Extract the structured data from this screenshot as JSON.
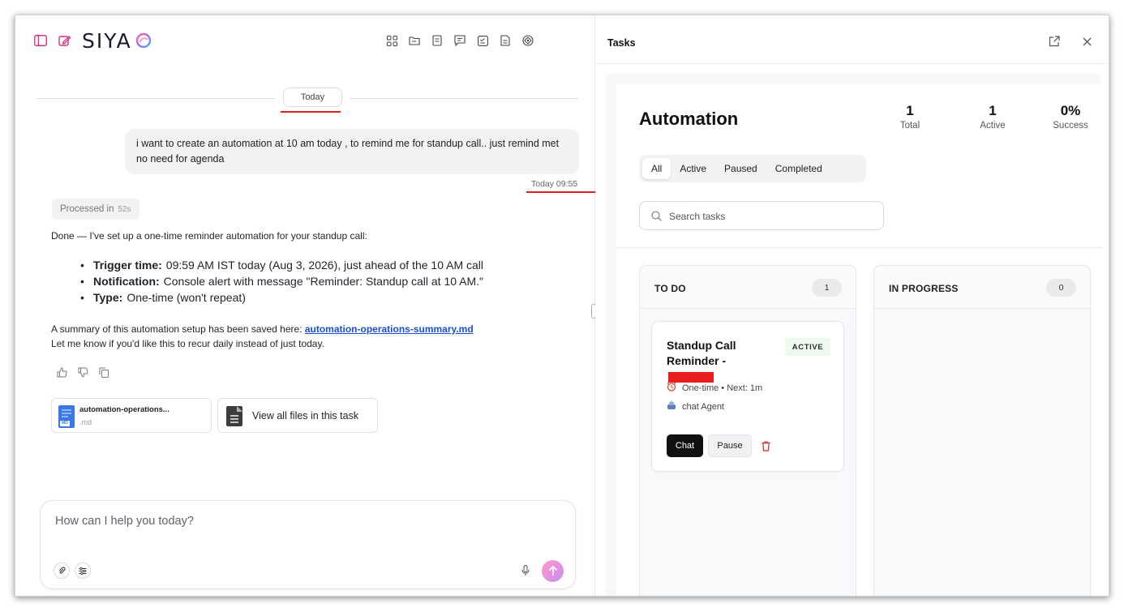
{
  "chat": {
    "logo_text": "SIYA",
    "date_divider": "Today",
    "user_message": "i want to create an automation at 10 am today , to remind me for standup call.. just remind met no need for agenda",
    "user_time": "Today 09:55",
    "processed_label": "Processed in",
    "processed_value": "52s",
    "response_intro": "Done — I've set up a one-time reminder automation for your standup call:",
    "bullets": [
      {
        "label": "Trigger time:",
        "text": "09:59 AM IST today (Aug 3, 2026), just ahead of the 10 AM call"
      },
      {
        "label": "Notification:",
        "text": "Console alert with message \"Reminder: Standup call at 10 AM.\""
      },
      {
        "label": "Type:",
        "text": "One-time (won't repeat)"
      }
    ],
    "summary_prefix": "A summary of this automation setup has been saved here: ",
    "summary_link": "automation-operations-summary.md",
    "followup": "Let me know if you'd like this to recur daily instead of just today.",
    "file_name": "automation-operations...",
    "file_ext": ".md",
    "file_icon_label": "MD",
    "view_all": "View all files in this task",
    "composer_placeholder": "How can I help you today?",
    "toolbar_icons": [
      "apps-grid-icon",
      "folder-icon",
      "document-icon",
      "chat-icon",
      "checklist-icon",
      "file-icon",
      "target-icon"
    ]
  },
  "tasks": {
    "panel_title": "Tasks",
    "heading": "Automation",
    "stats": [
      {
        "value": "1",
        "label": "Total"
      },
      {
        "value": "1",
        "label": "Active"
      },
      {
        "value": "0%",
        "label": "Success"
      }
    ],
    "filters": [
      "All",
      "Active",
      "Paused",
      "Completed"
    ],
    "active_filter": "All",
    "search_placeholder": "Search tasks",
    "columns": [
      {
        "title": "TO DO",
        "count": "1"
      },
      {
        "title": "IN PROGRESS",
        "count": "0"
      }
    ],
    "card": {
      "title": "Standup Call Reminder -",
      "badge": "ACTIVE",
      "schedule": "One-time • Next: 1m",
      "agent": "chat Agent",
      "chat_button": "Chat",
      "pause_button": "Pause"
    }
  },
  "colors": {
    "accent_red": "#e0211f",
    "link_blue": "#1a4fd6",
    "logo_pink": "#d63384",
    "send_gradient_start": "#ff9ac8",
    "send_gradient_end": "#c88cf0"
  }
}
